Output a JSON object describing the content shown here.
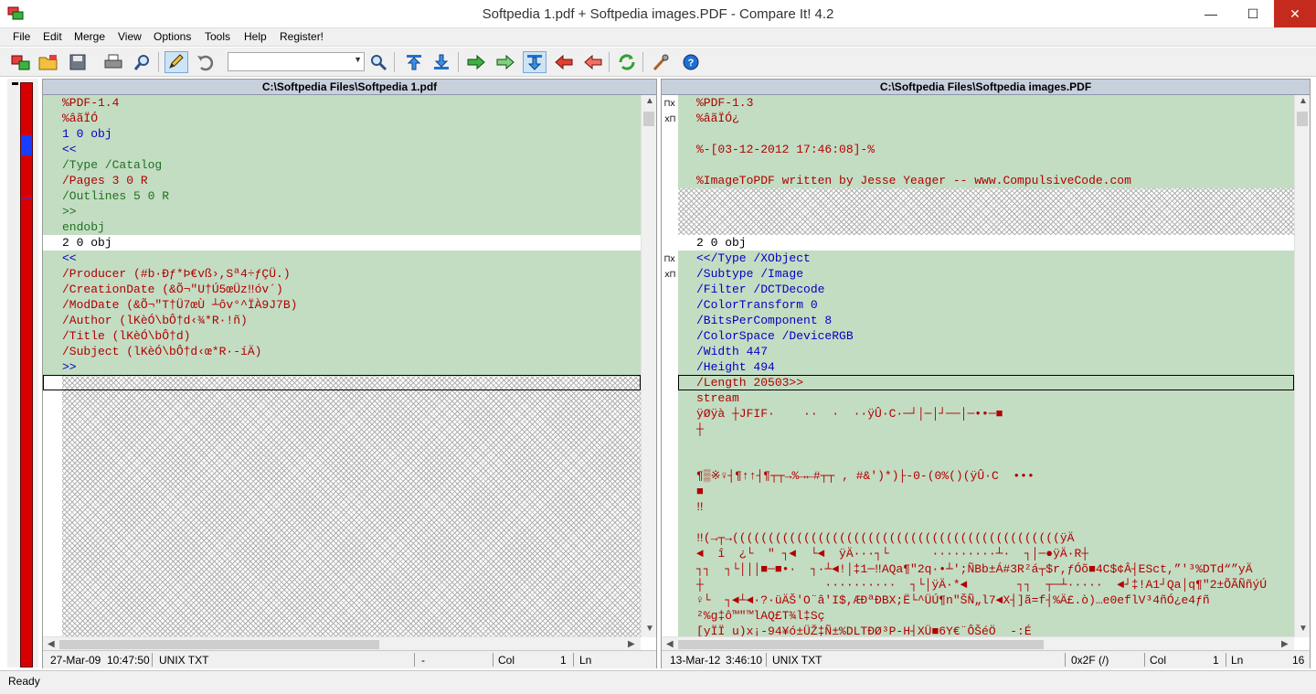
{
  "window": {
    "title": "Softpedia 1.pdf + Softpedia images.PDF - Compare It! 4.2",
    "minimize": "—",
    "maximize": "☐",
    "close": "✕"
  },
  "menu": [
    "File",
    "Edit",
    "Merge",
    "View",
    "Options",
    "Tools",
    "Help",
    "Register!"
  ],
  "toolbar": {
    "search_value": "",
    "icons": [
      "open-files-icon",
      "open-folders-icon",
      "save-icon",
      "print-icon",
      "print-preview-icon",
      "edit-mode-icon",
      "undo-icon",
      "find-icon",
      "first-difference-icon",
      "last-difference-icon",
      "copy-right-icon",
      "copy-all-right-icon",
      "next-difference-icon",
      "copy-left-icon",
      "copy-all-left-icon",
      "refresh-icon",
      "settings-wizard-icon",
      "help-icon"
    ]
  },
  "left": {
    "path": "C:\\Softpedia Files\\Softpedia 1.pdf",
    "status": {
      "date": "27-Mar-09",
      "time": "10:47:50",
      "format": "UNIX TXT",
      "pos": "-",
      "col_label": "Col",
      "col": "1",
      "ln_label": "Ln",
      "ln": ""
    },
    "lines": [
      {
        "t": "%PDF-1.4",
        "c": "c-red",
        "bg": "g"
      },
      {
        "t": "%âãÏÓ",
        "c": "c-red",
        "bg": "g"
      },
      {
        "t": "1 0 obj",
        "c": "c-blue",
        "bg": "g"
      },
      {
        "t": "<<",
        "c": "c-blue",
        "bg": "g"
      },
      {
        "t": "/Type /Catalog",
        "c": "c-green",
        "bg": "g"
      },
      {
        "t": "/Pages 3 0 R",
        "c": "c-red",
        "bg": "g"
      },
      {
        "t": "/Outlines 5 0 R",
        "c": "c-green",
        "bg": "g"
      },
      {
        "t": ">>",
        "c": "c-green",
        "bg": "g"
      },
      {
        "t": "endobj",
        "c": "c-green",
        "bg": "g"
      },
      {
        "t": "2 0 obj",
        "c": "c-black",
        "bg": "w"
      },
      {
        "t": "<<",
        "c": "c-blue",
        "bg": "g"
      },
      {
        "t": "/Producer (#b·Ðƒ*Þ€vß›,Sª4÷ƒÇÜ.)",
        "c": "c-red",
        "bg": "g"
      },
      {
        "t": "/CreationDate (&Õ¬\"U†Ú5œÜz‼óv´)",
        "c": "c-red",
        "bg": "g"
      },
      {
        "t": "/ModDate (&Õ¬\"T†Ü7œÙ ┴ôv°^ÏÀ9J7B)",
        "c": "c-red",
        "bg": "g"
      },
      {
        "t": "/Author (lKèÓ\\bÔ†d‹¾*R·!ñ)",
        "c": "c-red",
        "bg": "g"
      },
      {
        "t": "/Title (lKèÓ\\bÔ†d)",
        "c": "c-red",
        "bg": "g"
      },
      {
        "t": "/Subject (lKèÓ\\bÔ†d‹œ*R·-íÄ)",
        "c": "c-red",
        "bg": "g"
      },
      {
        "t": ">>",
        "c": "c-blue",
        "bg": "g"
      }
    ]
  },
  "right": {
    "path": "C:\\Softpedia Files\\Softpedia images.PDF",
    "status": {
      "date": "13-Mar-12",
      "time": "3:46:10",
      "format": "UNIX TXT",
      "pos": "0x2F (/)",
      "col_label": "Col",
      "col": "1",
      "ln_label": "Ln",
      "ln": "16"
    },
    "lines": [
      {
        "t": "%PDF-1.3",
        "c": "c-red",
        "bg": "g"
      },
      {
        "t": "%âãÏÓ¿",
        "c": "c-red",
        "bg": "g"
      },
      {
        "t": "",
        "c": "c-red",
        "bg": "g"
      },
      {
        "t": "%-[03-12-2012 17:46:08]-%",
        "c": "c-red",
        "bg": "g"
      },
      {
        "t": "",
        "c": "c-red",
        "bg": "g"
      },
      {
        "t": "%ImageToPDF written by Jesse Yeager -- www.CompulsiveCode.com",
        "c": "c-red",
        "bg": "g"
      },
      {
        "t": "",
        "c": "",
        "bg": "hatch"
      },
      {
        "t": "",
        "c": "",
        "bg": "hatch"
      },
      {
        "t": "",
        "c": "",
        "bg": "hatch"
      },
      {
        "t": "2 0 obj",
        "c": "c-black",
        "bg": "w"
      },
      {
        "t": "<</Type /XObject",
        "c": "c-blue",
        "bg": "g"
      },
      {
        "t": "/Subtype /Image",
        "c": "c-blue",
        "bg": "g"
      },
      {
        "t": "/Filter /DCTDecode",
        "c": "c-blue",
        "bg": "g"
      },
      {
        "t": "/ColorTransform 0",
        "c": "c-blue",
        "bg": "g"
      },
      {
        "t": "/BitsPerComponent 8",
        "c": "c-blue",
        "bg": "g"
      },
      {
        "t": "/ColorSpace /DeviceRGB",
        "c": "c-blue",
        "bg": "g"
      },
      {
        "t": "/Width 447",
        "c": "c-blue",
        "bg": "g"
      },
      {
        "t": "/Height 494",
        "c": "c-blue",
        "bg": "g"
      },
      {
        "t": "/Length 20503>>",
        "c": "c-red",
        "bg": "g"
      },
      {
        "t": "stream",
        "c": "c-red",
        "bg": "g"
      },
      {
        "t": "ÿØÿà ┼JFIF·    ··  ·  ··ÿÛ·C·─┘│─│┘──│─••─■",
        "c": "c-red",
        "bg": "g"
      },
      {
        "t": "┼",
        "c": "c-red",
        "bg": "g"
      },
      {
        "t": "",
        "c": "c-red",
        "bg": "g"
      },
      {
        "t": "",
        "c": "c-red",
        "bg": "g"
      },
      {
        "t": "¶▒※♀┤¶↑↑┤¶┬┬→%→←#┬┬ , #&')*)├-0-(0%()(ÿÛ·C  •••",
        "c": "c-red",
        "bg": "g"
      },
      {
        "t": "■",
        "c": "c-red",
        "bg": "g"
      },
      {
        "t": "‼",
        "c": "c-red",
        "bg": "g"
      },
      {
        "t": "",
        "c": "c-red",
        "bg": "g"
      },
      {
        "t": "‼(→┬→((((((((((((((((((((((((((((((((((((((((((((((ÿÄ",
        "c": "c-red",
        "bg": "g"
      },
      {
        "t": "◄  î  ¿└  \" ┐◄  └◄  ÿÄ···┐└      ·········┴·  ┐│─●ÿÄ·R┼",
        "c": "c-red",
        "bg": "g"
      },
      {
        "t": "┐┐  ┐└│││■─■•·  ┐·┴◄!│‡1─‼AQa¶\"2q·•┴';ÑBb±Á#3R²á┬$r,ƒÓõ■4C$¢Â┤ESct,”'³%DTd“”yÄ",
        "c": "c-red",
        "bg": "g"
      },
      {
        "t": "┼                 ··········  ┐└│ÿÄ·*◄       ┐┐  ┬─┴·····  ◄┘‡!A1┘Qa│q¶\"2±ÕÃÑñýÚ",
        "c": "c-red",
        "bg": "g"
      },
      {
        "t": "♀└  ┐◄┴◄·?·üÄŠ'O¨â'I$,ÆÐªÐBX;Ë└^ÜÚ¶n\"ŠÑ„l7◄X┤]ã=f┤%Ä£.ò)…e0eflV³4ñÓ¿e4ƒñ",
        "c": "c-red",
        "bg": "g"
      },
      {
        "t": "²%g‡ô™\"™lAQ£T¾l‡Sç",
        "c": "c-red",
        "bg": "g"
      },
      {
        "t": "[yÏÏ u)x¡-94¥ó±ÜŽ‡Ñ±%DLTÐØ³P-H┤XÜ■6Y€¨ÔŠéÖ  -:É",
        "c": "c-red",
        "bg": "g"
      }
    ]
  },
  "statusbar": {
    "text": "Ready"
  }
}
